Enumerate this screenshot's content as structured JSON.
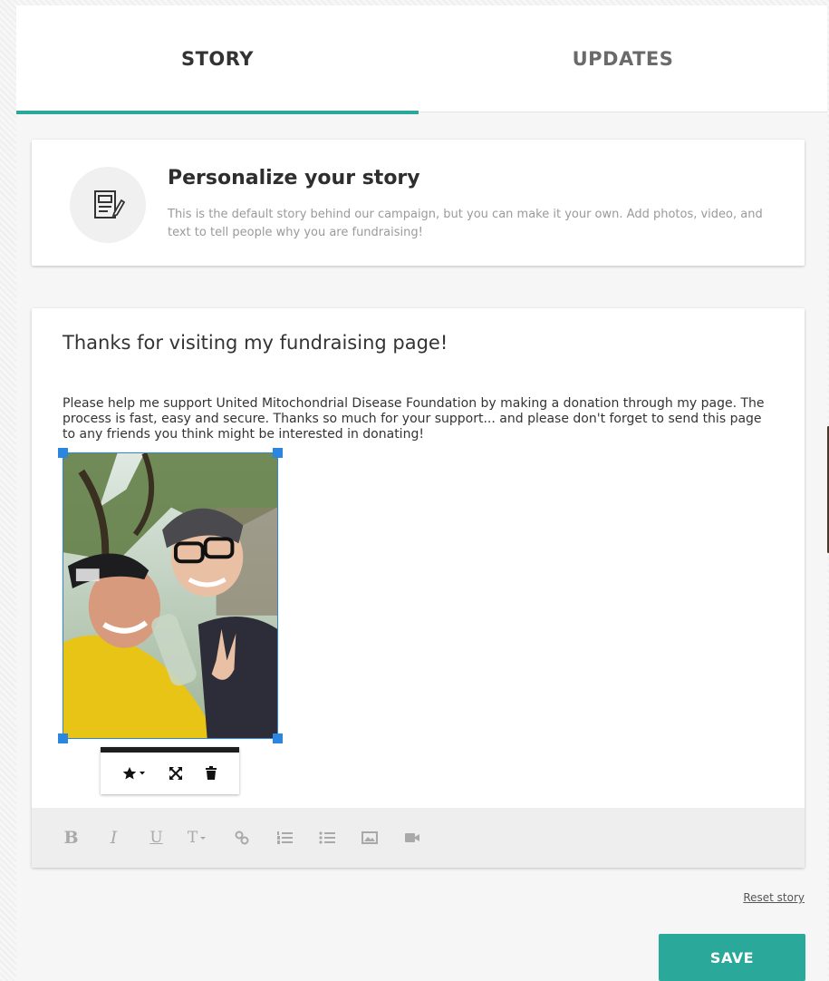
{
  "tabs": {
    "story": "STORY",
    "updates": "UPDATES",
    "active": "story",
    "accent_color": "#2aa89a"
  },
  "personalize": {
    "icon": "edit-document-icon",
    "title": "Personalize your story",
    "description": "This is the default story behind our campaign, but you can make it your own. Add photos, video, and text to tell people why you are fundraising!"
  },
  "editor": {
    "heading": "Thanks for visiting my fundraising page!",
    "body": "Please help me support United Mitochondrial Disease Foundation by making a donation through my page. The process is fast, easy and secure. Thanks so much for your support... and please don't forget to send this page to any friends you think might be interested in donating!",
    "image_toolbar": [
      "star-dropdown-icon",
      "resize-icon",
      "trash-icon"
    ],
    "format_toolbar": {
      "bold": "B",
      "italic": "I",
      "underline": "U",
      "text_size": "T",
      "icons": [
        "link-icon",
        "ordered-list-icon",
        "unordered-list-icon",
        "image-icon",
        "video-icon"
      ]
    }
  },
  "actions": {
    "reset": "Reset story",
    "save": "SAVE"
  }
}
